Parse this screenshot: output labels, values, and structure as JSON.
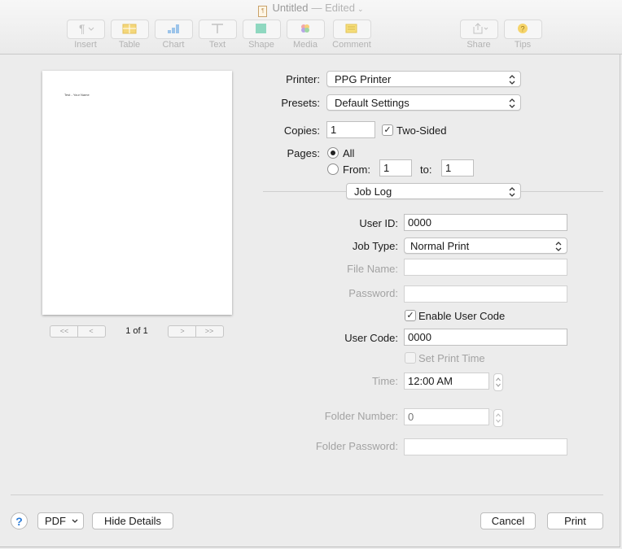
{
  "window": {
    "title": "Untitled",
    "status": "— Edited",
    "toolbar": [
      {
        "label": "Insert",
        "icon": "pilcrow-icon"
      },
      {
        "label": "Table",
        "icon": "table-icon"
      },
      {
        "label": "Chart",
        "icon": "chart-icon"
      },
      {
        "label": "Text",
        "icon": "text-icon"
      },
      {
        "label": "Shape",
        "icon": "shape-icon"
      },
      {
        "label": "Media",
        "icon": "media-icon"
      },
      {
        "label": "Comment",
        "icon": "comment-icon"
      },
      {
        "label": "Share",
        "icon": "share-icon"
      },
      {
        "label": "Tips",
        "icon": "tips-icon"
      }
    ]
  },
  "preview": {
    "page_text": "Test - Your Name",
    "page_count": "1 of 1"
  },
  "print": {
    "printer_label": "Printer:",
    "printer_value": "PPG Printer",
    "presets_label": "Presets:",
    "presets_value": "Default Settings",
    "copies_label": "Copies:",
    "copies_value": "1",
    "two_sided_label": "Two-Sided",
    "pages_label": "Pages:",
    "pages_all_label": "All",
    "pages_from_label": "From:",
    "pages_from_value": "1",
    "pages_to_label": "to:",
    "pages_to_value": "1",
    "section_value": "Job Log"
  },
  "job_log": {
    "user_id_label": "User ID:",
    "user_id_value": "0000",
    "job_type_label": "Job Type:",
    "job_type_value": "Normal Print",
    "file_name_label": "File Name:",
    "password_label": "Password:",
    "enable_user_code_label": "Enable User Code",
    "user_code_label": "User Code:",
    "user_code_value": "0000",
    "set_print_time_label": "Set Print Time",
    "time_label": "Time:",
    "time_value": "12:00 AM",
    "folder_number_label": "Folder Number:",
    "folder_number_placeholder": "0",
    "folder_password_label": "Folder Password:"
  },
  "footer": {
    "help_label": "?",
    "pdf_label": "PDF",
    "hide_details_label": "Hide Details",
    "cancel_label": "Cancel",
    "print_label": "Print"
  }
}
